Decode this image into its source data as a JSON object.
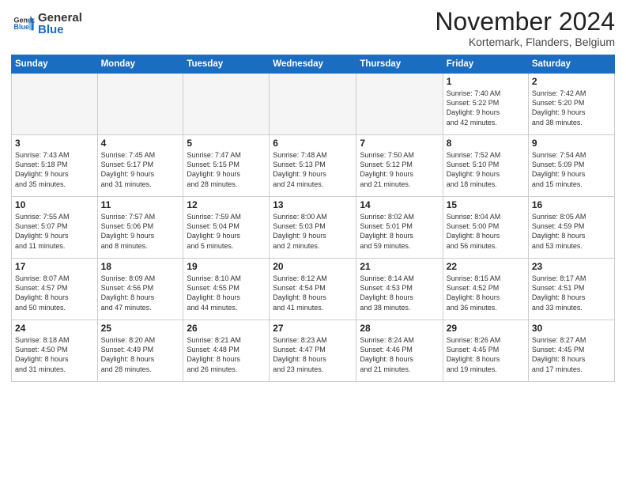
{
  "header": {
    "logo_general": "General",
    "logo_blue": "Blue",
    "month_title": "November 2024",
    "location": "Kortemark, Flanders, Belgium"
  },
  "days_of_week": [
    "Sunday",
    "Monday",
    "Tuesday",
    "Wednesday",
    "Thursday",
    "Friday",
    "Saturday"
  ],
  "weeks": [
    [
      {
        "day": "",
        "info": ""
      },
      {
        "day": "",
        "info": ""
      },
      {
        "day": "",
        "info": ""
      },
      {
        "day": "",
        "info": ""
      },
      {
        "day": "",
        "info": ""
      },
      {
        "day": "1",
        "info": "Sunrise: 7:40 AM\nSunset: 5:22 PM\nDaylight: 9 hours\nand 42 minutes."
      },
      {
        "day": "2",
        "info": "Sunrise: 7:42 AM\nSunset: 5:20 PM\nDaylight: 9 hours\nand 38 minutes."
      }
    ],
    [
      {
        "day": "3",
        "info": "Sunrise: 7:43 AM\nSunset: 5:18 PM\nDaylight: 9 hours\nand 35 minutes."
      },
      {
        "day": "4",
        "info": "Sunrise: 7:45 AM\nSunset: 5:17 PM\nDaylight: 9 hours\nand 31 minutes."
      },
      {
        "day": "5",
        "info": "Sunrise: 7:47 AM\nSunset: 5:15 PM\nDaylight: 9 hours\nand 28 minutes."
      },
      {
        "day": "6",
        "info": "Sunrise: 7:48 AM\nSunset: 5:13 PM\nDaylight: 9 hours\nand 24 minutes."
      },
      {
        "day": "7",
        "info": "Sunrise: 7:50 AM\nSunset: 5:12 PM\nDaylight: 9 hours\nand 21 minutes."
      },
      {
        "day": "8",
        "info": "Sunrise: 7:52 AM\nSunset: 5:10 PM\nDaylight: 9 hours\nand 18 minutes."
      },
      {
        "day": "9",
        "info": "Sunrise: 7:54 AM\nSunset: 5:09 PM\nDaylight: 9 hours\nand 15 minutes."
      }
    ],
    [
      {
        "day": "10",
        "info": "Sunrise: 7:55 AM\nSunset: 5:07 PM\nDaylight: 9 hours\nand 11 minutes."
      },
      {
        "day": "11",
        "info": "Sunrise: 7:57 AM\nSunset: 5:06 PM\nDaylight: 9 hours\nand 8 minutes."
      },
      {
        "day": "12",
        "info": "Sunrise: 7:59 AM\nSunset: 5:04 PM\nDaylight: 9 hours\nand 5 minutes."
      },
      {
        "day": "13",
        "info": "Sunrise: 8:00 AM\nSunset: 5:03 PM\nDaylight: 9 hours\nand 2 minutes."
      },
      {
        "day": "14",
        "info": "Sunrise: 8:02 AM\nSunset: 5:01 PM\nDaylight: 8 hours\nand 59 minutes."
      },
      {
        "day": "15",
        "info": "Sunrise: 8:04 AM\nSunset: 5:00 PM\nDaylight: 8 hours\nand 56 minutes."
      },
      {
        "day": "16",
        "info": "Sunrise: 8:05 AM\nSunset: 4:59 PM\nDaylight: 8 hours\nand 53 minutes."
      }
    ],
    [
      {
        "day": "17",
        "info": "Sunrise: 8:07 AM\nSunset: 4:57 PM\nDaylight: 8 hours\nand 50 minutes."
      },
      {
        "day": "18",
        "info": "Sunrise: 8:09 AM\nSunset: 4:56 PM\nDaylight: 8 hours\nand 47 minutes."
      },
      {
        "day": "19",
        "info": "Sunrise: 8:10 AM\nSunset: 4:55 PM\nDaylight: 8 hours\nand 44 minutes."
      },
      {
        "day": "20",
        "info": "Sunrise: 8:12 AM\nSunset: 4:54 PM\nDaylight: 8 hours\nand 41 minutes."
      },
      {
        "day": "21",
        "info": "Sunrise: 8:14 AM\nSunset: 4:53 PM\nDaylight: 8 hours\nand 38 minutes."
      },
      {
        "day": "22",
        "info": "Sunrise: 8:15 AM\nSunset: 4:52 PM\nDaylight: 8 hours\nand 36 minutes."
      },
      {
        "day": "23",
        "info": "Sunrise: 8:17 AM\nSunset: 4:51 PM\nDaylight: 8 hours\nand 33 minutes."
      }
    ],
    [
      {
        "day": "24",
        "info": "Sunrise: 8:18 AM\nSunset: 4:50 PM\nDaylight: 8 hours\nand 31 minutes."
      },
      {
        "day": "25",
        "info": "Sunrise: 8:20 AM\nSunset: 4:49 PM\nDaylight: 8 hours\nand 28 minutes."
      },
      {
        "day": "26",
        "info": "Sunrise: 8:21 AM\nSunset: 4:48 PM\nDaylight: 8 hours\nand 26 minutes."
      },
      {
        "day": "27",
        "info": "Sunrise: 8:23 AM\nSunset: 4:47 PM\nDaylight: 8 hours\nand 23 minutes."
      },
      {
        "day": "28",
        "info": "Sunrise: 8:24 AM\nSunset: 4:46 PM\nDaylight: 8 hours\nand 21 minutes."
      },
      {
        "day": "29",
        "info": "Sunrise: 8:26 AM\nSunset: 4:45 PM\nDaylight: 8 hours\nand 19 minutes."
      },
      {
        "day": "30",
        "info": "Sunrise: 8:27 AM\nSunset: 4:45 PM\nDaylight: 8 hours\nand 17 minutes."
      }
    ]
  ]
}
